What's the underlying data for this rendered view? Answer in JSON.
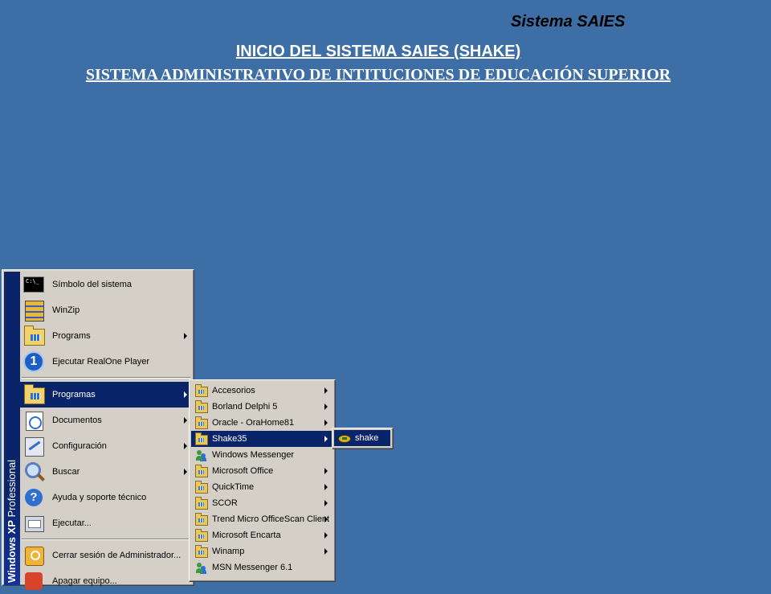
{
  "header": {
    "system_name": "Sistema SAIES",
    "title": "INICIO DEL SISTEMA SAIES (SHAKE)",
    "subtitle": "SISTEMA ADMINISTRATIVO DE INTITUCIONES DE EDUCACIÓN SUPERIOR"
  },
  "start_menu": {
    "banner_bold": "Windows XP",
    "banner_light": " Professional",
    "items": [
      {
        "label": "Símbolo del sistema",
        "icon": "command-prompt-icon",
        "cmd_text": "C:\\_"
      },
      {
        "label": "WinZip",
        "icon": "winzip-icon"
      },
      {
        "label": "Programs",
        "icon": "programs-folder-icon"
      },
      {
        "label": "Ejecutar RealOne Player",
        "icon": "realone-icon",
        "badge": "1"
      },
      {
        "label": "Programas",
        "icon": "programas-folder-icon"
      },
      {
        "label": "Documentos",
        "icon": "documents-icon"
      },
      {
        "label": "Configuración",
        "icon": "settings-icon"
      },
      {
        "label": "Buscar",
        "icon": "search-icon"
      },
      {
        "label": "Ayuda y soporte técnico",
        "icon": "help-icon",
        "badge": "?"
      },
      {
        "label": "Ejecutar...",
        "icon": "run-icon"
      },
      {
        "label": "Cerrar sesión de Administrador...",
        "icon": "logoff-icon"
      },
      {
        "label": "Apagar equipo...",
        "icon": "shutdown-icon"
      }
    ]
  },
  "programas_submenu": {
    "items": [
      {
        "label": "Accesorios",
        "icon": "folder-icon"
      },
      {
        "label": "Borland Delphi 5",
        "icon": "folder-icon"
      },
      {
        "label": "Oracle - OraHome81",
        "icon": "folder-icon"
      },
      {
        "label": "Shake35",
        "icon": "folder-icon"
      },
      {
        "label": "Windows Messenger",
        "icon": "messenger-icon"
      },
      {
        "label": "Microsoft Office",
        "icon": "folder-icon"
      },
      {
        "label": "QuickTime",
        "icon": "folder-icon"
      },
      {
        "label": "SCOR",
        "icon": "folder-icon"
      },
      {
        "label": "Trend Micro OfficeScan Client",
        "icon": "folder-icon"
      },
      {
        "label": "Microsoft Encarta",
        "icon": "folder-icon"
      },
      {
        "label": "Winamp",
        "icon": "folder-icon"
      },
      {
        "label": "MSN Messenger 6.1",
        "icon": "messenger-icon"
      }
    ]
  },
  "shake_submenu": {
    "items": [
      {
        "label": "shake",
        "icon": "shake-app-icon"
      }
    ]
  },
  "colors": {
    "background": "#3d6ea5",
    "menu_face": "#d4d0c8",
    "selection": "#0a246a"
  }
}
